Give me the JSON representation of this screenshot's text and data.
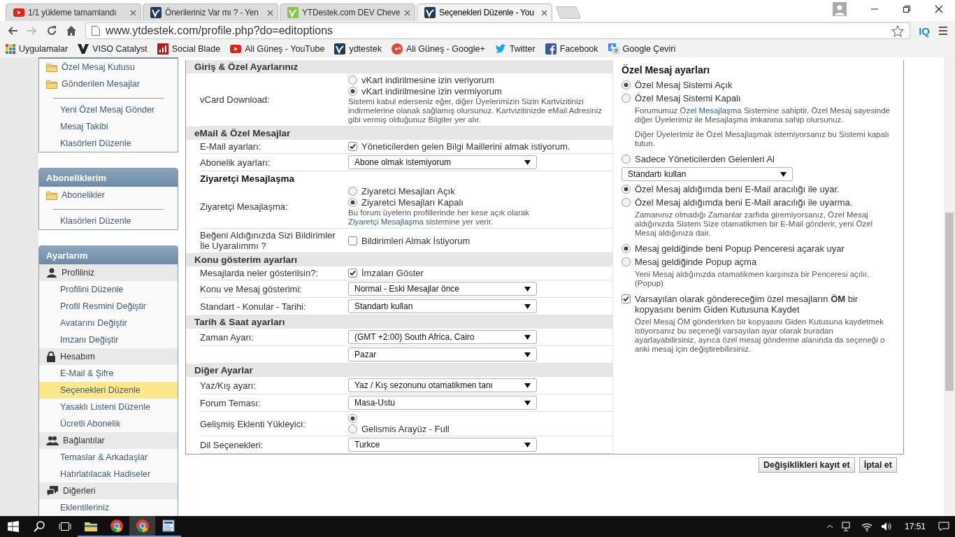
{
  "browser": {
    "tabs": [
      {
        "title": "1/1 yükleme tamamlandı",
        "kind": "play",
        "selected": false
      },
      {
        "title": "Önerileriniz Var mı ? - Yen",
        "kind": "site",
        "selected": false
      },
      {
        "title": "YTDestek.com DEV Cheve",
        "kind": "leaf",
        "selected": false
      },
      {
        "title": "Seçenekleri Düzenle - You",
        "kind": "site",
        "selected": true
      }
    ],
    "address": "www.ytdestek.com/profile.php?do=editoptions",
    "extension": "IQ",
    "bookmarks": [
      {
        "label": "Uygulamalar",
        "kind": "grid"
      },
      {
        "label": "VISO Catalyst",
        "kind": "v"
      },
      {
        "label": "Social Blade",
        "kind": "bars"
      },
      {
        "label": "Ali Güneş - YouTube",
        "kind": "play"
      },
      {
        "label": "ydtestek",
        "kind": "site"
      },
      {
        "label": "Ali Güneş - Google+",
        "kind": "gplus"
      },
      {
        "label": "Twitter",
        "kind": "bird"
      },
      {
        "label": "Facebook",
        "kind": "f"
      },
      {
        "label": "Google Çeviri",
        "kind": "translate"
      }
    ]
  },
  "sidebar": [
    {
      "items": [
        {
          "label": "Özel Mesaj Kutusu",
          "kind": "folder",
          "selected": false
        },
        {
          "label": "Gönderilen Mesajlar",
          "kind": "folder",
          "selected": false
        },
        {
          "label": "Yeni Özel Mesaj Gönder",
          "kind": "link",
          "selected": false
        },
        {
          "label": "Mesaj Takibi",
          "kind": "link",
          "selected": false
        },
        {
          "label": "Klasörleri Düzenle",
          "kind": "link",
          "selected": false
        }
      ]
    },
    {
      "title": "Aboneliklerim",
      "items": [
        {
          "label": "Abonelikler",
          "kind": "folder",
          "selected": false
        },
        {
          "label": "Klasörleri Düzenle",
          "kind": "link",
          "selected": false
        }
      ]
    },
    {
      "title": "Ayarlarım",
      "items": [
        {
          "label": "Profiliniz",
          "kind": "category",
          "selected": false
        },
        {
          "label": "Profilini Düzenle",
          "kind": "link",
          "selected": false
        },
        {
          "label": "Profil Resmini Değiştir",
          "kind": "link",
          "selected": false
        },
        {
          "label": "Avatarını Değiştir",
          "kind": "link",
          "selected": false
        },
        {
          "label": "Imzanı Değiştir",
          "kind": "link",
          "selected": false
        },
        {
          "label": "Hesabım",
          "kind": "category",
          "selected": false
        },
        {
          "label": "E-Mail & Şifre",
          "kind": "link",
          "selected": false
        },
        {
          "label": "Seçenekleri Düzenle",
          "kind": "link",
          "selected": true
        },
        {
          "label": "Yasaklı Listeni Düzenle",
          "kind": "link",
          "selected": false
        },
        {
          "label": "Ücretli Abonelik",
          "kind": "link",
          "selected": false
        },
        {
          "label": "Bağlantılar",
          "kind": "category",
          "selected": false
        },
        {
          "label": "Temaslar & Arkadaşlar",
          "kind": "link",
          "selected": false
        },
        {
          "label": "Hatırlatılacak Hadiseler",
          "kind": "link",
          "selected": false
        },
        {
          "label": "Diğerleri",
          "kind": "category",
          "selected": false
        },
        {
          "label": "Eklentileriniz",
          "kind": "link",
          "selected": false
        }
      ]
    }
  ],
  "form": {
    "rows": [
      {
        "kind": "header",
        "text": "Giriş & Özel Ayarlarınız"
      },
      {
        "kind": "field",
        "label": "vCard Download:",
        "controls": [
          {
            "kind": "radio",
            "label": "vKart indirilmesine izin veriyorum",
            "selected": false
          },
          {
            "kind": "radio",
            "label": "vKart indirilmesine izin vermiyorum",
            "selected": true
          }
        ],
        "description": [
          {
            "text": "Sistemi kabul ederseniz eğer, diğer Üyelerimizin Sizin Kartvizitinizi indirmelerine olanak sağlamış olursunuz. Kartvizitinizde eMail Adresiniz gibi vermiş olduğunuz Bilgiler yer alır."
          }
        ]
      },
      {
        "kind": "header",
        "text": "eMail & Özel Mesajlar"
      },
      {
        "kind": "field",
        "label": "E-Mail ayarları:",
        "controls": [
          {
            "kind": "checkbox",
            "label": "Yöneticilerden gelen Bilgi Maillerini almak istiyorum.",
            "checked": true
          }
        ]
      },
      {
        "kind": "field",
        "label": "Abonelik ayarları:",
        "controls": [
          {
            "kind": "select",
            "value": "Abone olmak istemiyorum"
          }
        ]
      },
      {
        "kind": "subheader",
        "text": "Ziyaretçi Mesajlaşma"
      },
      {
        "kind": "field",
        "label": "Ziyaretçi Mesajlaşma:",
        "controls": [
          {
            "kind": "radio",
            "label": "Ziyaretci Mesajları Açık",
            "selected": false
          },
          {
            "kind": "radio",
            "label": "Ziyaretci Mesajları Kapalı",
            "selected": true
          }
        ],
        "description": [
          {
            "text": "Bu forum üyelerin profillerinde her kese açık olarak "
          },
          {
            "text": "Ziyaretçi Mesajlaşma",
            "link": true
          },
          {
            "text": " sistemine yer verir."
          }
        ]
      },
      {
        "kind": "field",
        "label": "Beğeni Aldığınızda Sizi Bildirimler İle Uyaralımmı ?",
        "controls": [
          {
            "kind": "checkbox",
            "label": "Bildirimleri Almak İstiyorum",
            "checked": false
          }
        ]
      },
      {
        "kind": "header",
        "text": "Konu gösterim ayarları"
      },
      {
        "kind": "field",
        "label": "Mesajlarda neler gösterilsin?:",
        "controls": [
          {
            "kind": "checkbox",
            "label": "İmzaları Göster",
            "checked": true
          }
        ]
      },
      {
        "kind": "field",
        "label": "Konu ve Mesaj gösterimi:",
        "controls": [
          {
            "kind": "select",
            "value": "Normal - Eski Mesajlar önce"
          }
        ]
      },
      {
        "kind": "field",
        "label": "Standart - Konular - Tarihi:",
        "controls": [
          {
            "kind": "select",
            "value": "Standartı kullan"
          }
        ]
      },
      {
        "kind": "header",
        "text": "Tarih & Saat ayarları"
      },
      {
        "kind": "field",
        "label": "Zaman Ayarı:",
        "controls": [
          {
            "kind": "select",
            "value": "(GMT +2:00) South Africa, Cairo"
          }
        ]
      },
      {
        "kind": "field",
        "controls": [
          {
            "kind": "select",
            "value": "Pazar"
          }
        ]
      },
      {
        "kind": "header",
        "text": "Diğer Ayarlar"
      },
      {
        "kind": "field",
        "label": "Yaz/Kış ayarı:",
        "controls": [
          {
            "kind": "select",
            "value": "Yaz / Kış sezonunu otamatikmen tanı"
          }
        ]
      },
      {
        "kind": "field",
        "label": "Forum Teması:",
        "controls": [
          {
            "kind": "select",
            "value": "Masa-Ustu"
          }
        ]
      },
      {
        "kind": "field",
        "label": "Gelişmiş Eklenti Yükleyici:",
        "controls": [
          {
            "kind": "radio",
            "selected": true
          },
          {
            "kind": "radio",
            "label": "Gelismis Arayüz - Full",
            "selected": false
          }
        ]
      },
      {
        "kind": "field",
        "label": "Dil Seçenekleri:",
        "controls": [
          {
            "kind": "select",
            "value": "Turkce"
          }
        ]
      }
    ]
  },
  "private_messages": {
    "title": "Özel Mesaj ayarları",
    "items": [
      {
        "kind": "radio",
        "label": "Özel Mesaj Sistemi Açık",
        "selected": true
      },
      {
        "kind": "radio",
        "label": "Özel Mesaj Sistemi Kapalı",
        "selected": false
      },
      {
        "kind": "description",
        "parts": [
          {
            "text": "Forumumuz "
          },
          {
            "text": "Özel Mesajlaşma",
            "link": true
          },
          {
            "text": " Sistemine sahiptir. Özel Mesaj sayesinde diğer Üyelerimiz ile Mesajlaşma imkanına sahip olursunuz."
          }
        ]
      },
      {
        "kind": "description",
        "parts": [
          {
            "text": "Diğer Üyelerimiz ile Özel Mesajlaşmak istemiyorsanız bu Sistemi kapalı tutun."
          }
        ]
      },
      {
        "kind": "radio",
        "label": "Sadece Yöneticilerden Gelenleri Al",
        "selected": false
      },
      {
        "kind": "select",
        "value": "Standartı kullan"
      },
      {
        "kind": "radio",
        "label": "Özel Mesaj aldığımda beni E-Mail aracılığı ile uyar.",
        "selected": true
      },
      {
        "kind": "radio",
        "label": "Özel Mesaj aldığımda beni E-Mail aracılığı ile uyarma.",
        "selected": false
      },
      {
        "kind": "description",
        "parts": [
          {
            "text": "Zamanınız olmadığı Zamanlar zarfıda giremiyorsanız, Özel Mesaj aldığınızda Sistem Size otamatikmen bir E-Mail gönderir, yeni Özel Mesaj aldığınıza dair."
          }
        ]
      },
      {
        "kind": "radio",
        "label": "Mesaj geldiğinde beni Popup Penceresi açarak uyar",
        "selected": true
      },
      {
        "kind": "radio",
        "label": "Mesaj geldiğinde Popup açma",
        "selected": false
      },
      {
        "kind": "description",
        "parts": [
          {
            "text": "Yeni Mesaj aldığınızda otamatikmen karşınıza bir Penceresi açılır. (Popup)"
          }
        ]
      },
      {
        "kind": "checkbox",
        "label": "Varsayılan olarak göndereceğim özel mesajların **ÖM** bir kopyasını benim Giden Kutusuna Kaydet",
        "checked": true
      },
      {
        "kind": "description",
        "parts": [
          {
            "text": "Özel Mesaj ÖM gönderirken bir kopyasını Giden Kutusuna kaydetmek istiyorsanız bu seçeneği varsayılan ayar olarak buradan ayarlayabilirsiniz, ayrıca özel mesaj gönderme alanında da seçeneği o anki mesaj için değiştirebilirsiniz."
          }
        ]
      }
    ]
  },
  "actions": [
    "Değişiklikleri kayıt et",
    "İptal et"
  ],
  "taskbar": {
    "apps": [
      {
        "kind": "folder",
        "selected": false
      },
      {
        "kind": "browser",
        "selected": false
      },
      {
        "kind": "browser",
        "selected": true
      },
      {
        "kind": "document",
        "selected": false
      }
    ],
    "clock": "17:51"
  }
}
